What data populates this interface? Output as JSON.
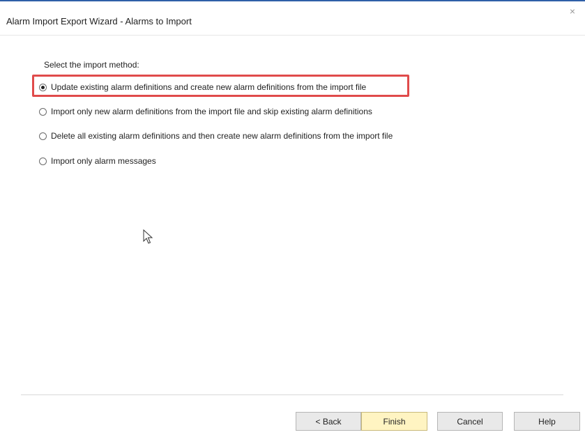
{
  "window": {
    "title": "Alarm Import Export Wizard - Alarms to Import",
    "close_glyph": "×"
  },
  "main": {
    "prompt": "Select the import method:",
    "options": [
      {
        "label": "Update existing alarm definitions and create new alarm definitions from the import file",
        "selected": true
      },
      {
        "label": "Import only new alarm definitions from the import file and skip existing alarm definitions",
        "selected": false
      },
      {
        "label": "Delete all existing alarm definitions and then create new alarm definitions from the import file",
        "selected": false
      },
      {
        "label": "Import only alarm messages",
        "selected": false
      }
    ]
  },
  "footer": {
    "back_label": "< Back",
    "finish_label": "Finish",
    "cancel_label": "Cancel",
    "help_label": "Help"
  },
  "colors": {
    "accent_border": "#2f5fa8",
    "highlight_box": "#e04b4b",
    "default_button": "#fff4c2"
  },
  "icons": {
    "close": "close-icon",
    "cursor": "mouse-pointer-icon"
  }
}
